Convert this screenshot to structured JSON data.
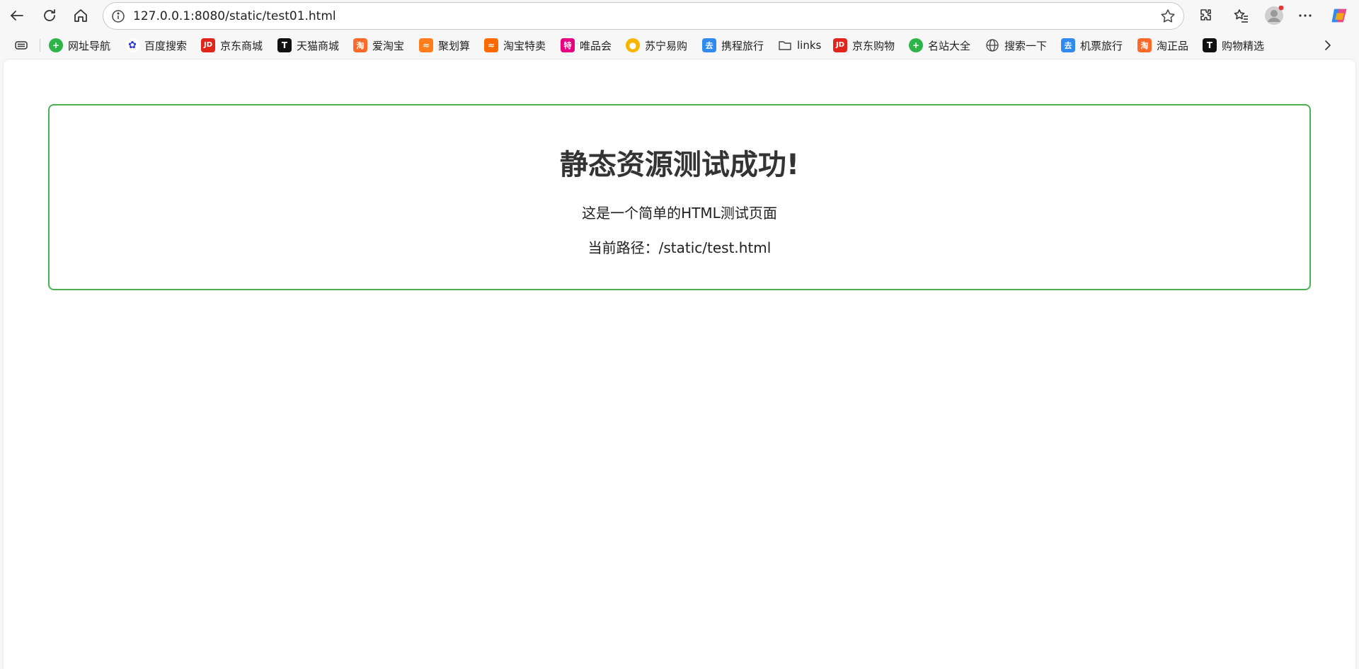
{
  "browser": {
    "url": "127.0.0.1:8080/static/test01.html",
    "bookmarks": [
      {
        "label": "网址导航",
        "icon": "web-nav-icon",
        "color": "#2fb44a",
        "glyph": "+"
      },
      {
        "label": "百度搜索",
        "icon": "baidu-icon",
        "color": "#2932e1",
        "glyph": "🐾"
      },
      {
        "label": "京东商城",
        "icon": "jd-icon",
        "color": "#e1251b",
        "glyph": "JD"
      },
      {
        "label": "天猫商城",
        "icon": "tmall-icon",
        "color": "#e50012",
        "glyph": "T"
      },
      {
        "label": "爱淘宝",
        "icon": "aitaobao-icon",
        "color": "#ff6a2b",
        "glyph": "淘"
      },
      {
        "label": "聚划算",
        "icon": "juhuasuan-icon",
        "color": "#ff7d1a",
        "glyph": "≈"
      },
      {
        "label": "淘宝特卖",
        "icon": "taobao-sale-icon",
        "color": "#ff6a00",
        "glyph": "≈"
      },
      {
        "label": "唯品会",
        "icon": "vip-icon",
        "color": "#e4007f",
        "glyph": "特"
      },
      {
        "label": "苏宁易购",
        "icon": "suning-icon",
        "color": "#f7b500",
        "glyph": "🦁"
      },
      {
        "label": "携程旅行",
        "icon": "ctrip-icon",
        "color": "#2f8bf0",
        "glyph": "去"
      },
      {
        "label": "links",
        "icon": "folder-icon",
        "color": "#555555",
        "glyph": ""
      },
      {
        "label": "京东购物",
        "icon": "jd-shopping-icon",
        "color": "#e1251b",
        "glyph": "JD"
      },
      {
        "label": "名站大全",
        "icon": "site-list-icon",
        "color": "#2fb44a",
        "glyph": "+"
      },
      {
        "label": "搜索一下",
        "icon": "globe-icon",
        "color": "#555555",
        "glyph": ""
      },
      {
        "label": "机票旅行",
        "icon": "flight-icon",
        "color": "#2f8bf0",
        "glyph": "去"
      },
      {
        "label": "淘正品",
        "icon": "taozhengpin-icon",
        "color": "#ff6a2b",
        "glyph": "淘"
      },
      {
        "label": "购物精选",
        "icon": "shopping-select-icon",
        "color": "#e50012",
        "glyph": "T"
      }
    ]
  },
  "page": {
    "heading": "静态资源测试成功!",
    "description": "这是一个简单的HTML测试页面",
    "path_text": "当前路径：/static/test.html"
  },
  "colors": {
    "card_border": "#4caf50",
    "heading": "#333333"
  }
}
